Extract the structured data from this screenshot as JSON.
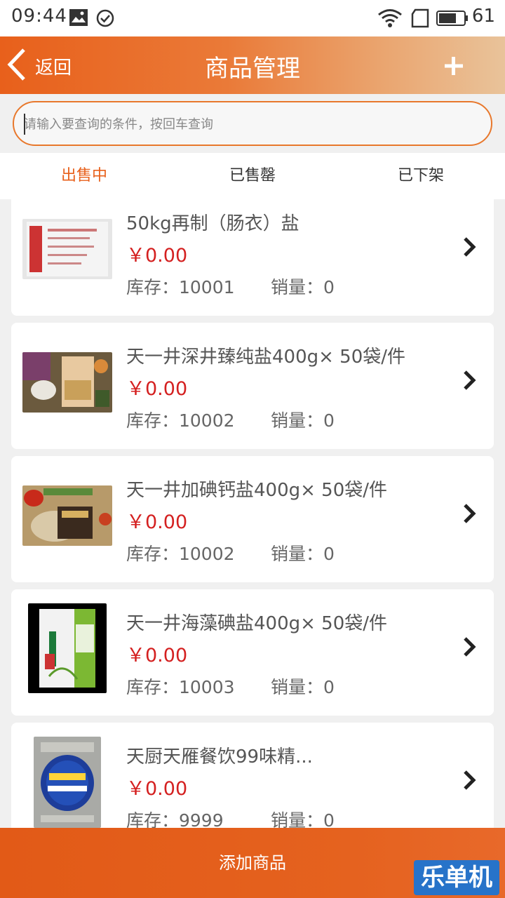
{
  "status_bar": {
    "time": "09:44",
    "battery": "61"
  },
  "header": {
    "back_label": "返回",
    "title": "商品管理"
  },
  "search": {
    "placeholder": "请输入要查询的条件，按回车查询",
    "value": ""
  },
  "tabs": [
    {
      "label": "出售中",
      "active": true
    },
    {
      "label": "已售罄",
      "active": false
    },
    {
      "label": "已下架",
      "active": false
    }
  ],
  "products": [
    {
      "name": "50kg再制（肠衣）盐",
      "price": "￥0.00",
      "stock": "库存：10001",
      "sales": "销量：0",
      "thumb": "salt-bag-white-image"
    },
    {
      "name": "天一井深井臻纯盐400g× 50袋/件",
      "price": "￥0.00",
      "stock": "库存：10002",
      "sales": "销量：0",
      "thumb": "salt-package-food-image"
    },
    {
      "name": "天一井加碘钙盐400g× 50袋/件",
      "price": "￥0.00",
      "stock": "库存：10002",
      "sales": "销量：0",
      "thumb": "salt-package-vegetables-image"
    },
    {
      "name": "天一井海藻碘盐400g× 50袋/件",
      "price": "￥0.00",
      "stock": "库存：10003",
      "sales": "销量：0",
      "thumb": "seaweed-salt-bag-image"
    },
    {
      "name": "天厨天雁餐饮99味精...",
      "price": "￥0.00",
      "stock": "库存：9999",
      "sales": "销量：0",
      "thumb": "msg-bag-image"
    }
  ],
  "bottom": {
    "add_label": "添加商品"
  },
  "watermark": "乐单机",
  "colors": {
    "accent": "#e8601b",
    "price": "#d42020"
  }
}
